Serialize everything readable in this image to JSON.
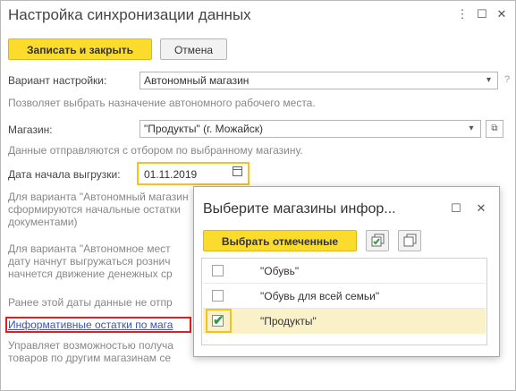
{
  "window": {
    "title": "Настройка синхронизации данных",
    "more_icon": "⋮",
    "maximize_icon": "☐",
    "close_icon": "✕"
  },
  "toolbar": {
    "save_close_label": "Записать и закрыть",
    "cancel_label": "Отмена"
  },
  "form": {
    "variant_label": "Вариант настройки:",
    "variant_value": "Автономный магазин",
    "variant_hint": "Позволяет выбрать назначение автономного рабочего места.",
    "store_label": "Магазин:",
    "store_value": "\"Продукты\" (г. Можайск)",
    "store_hint": "Данные отправляются с отбором по выбранному магазину.",
    "date_label": "Дата начала выгрузки:",
    "date_value": "01.11.2019",
    "help_line1": "Для варианта \"Автономный магазин",
    "help_line2": "сформируются начальные остатки",
    "help_line3": "документами)",
    "help_line4": "Для варианта \"Автономное мест",
    "help_line5": "дату начнут выгружаться рознич",
    "help_line6": "начнется движение денежных ср",
    "help_line7": "Ранее этой даты данные не отпр",
    "info_link": "Информативные остатки по мага",
    "info_hint1": "Управляет возможностью получа",
    "info_hint2": "товаров по другим магазинам се",
    "qmark": "?"
  },
  "dialog": {
    "title": "Выберите магазины инфор...",
    "select_checked_label": "Выбрать отмеченные",
    "items": [
      {
        "label": "\"Обувь\"",
        "checked": false
      },
      {
        "label": "\"Обувь для всей семьи\"",
        "checked": false
      },
      {
        "label": "\"Продукты\"",
        "checked": true
      }
    ],
    "check_mark": "✔",
    "colors": {
      "selected_row": "#fbf1c9",
      "focus_border": "#f3c21d",
      "check": "#2d9f3a"
    }
  },
  "colors": {
    "accent": "#fbdb2c",
    "link": "#3a56a8",
    "highlight_box": "#e02020"
  }
}
